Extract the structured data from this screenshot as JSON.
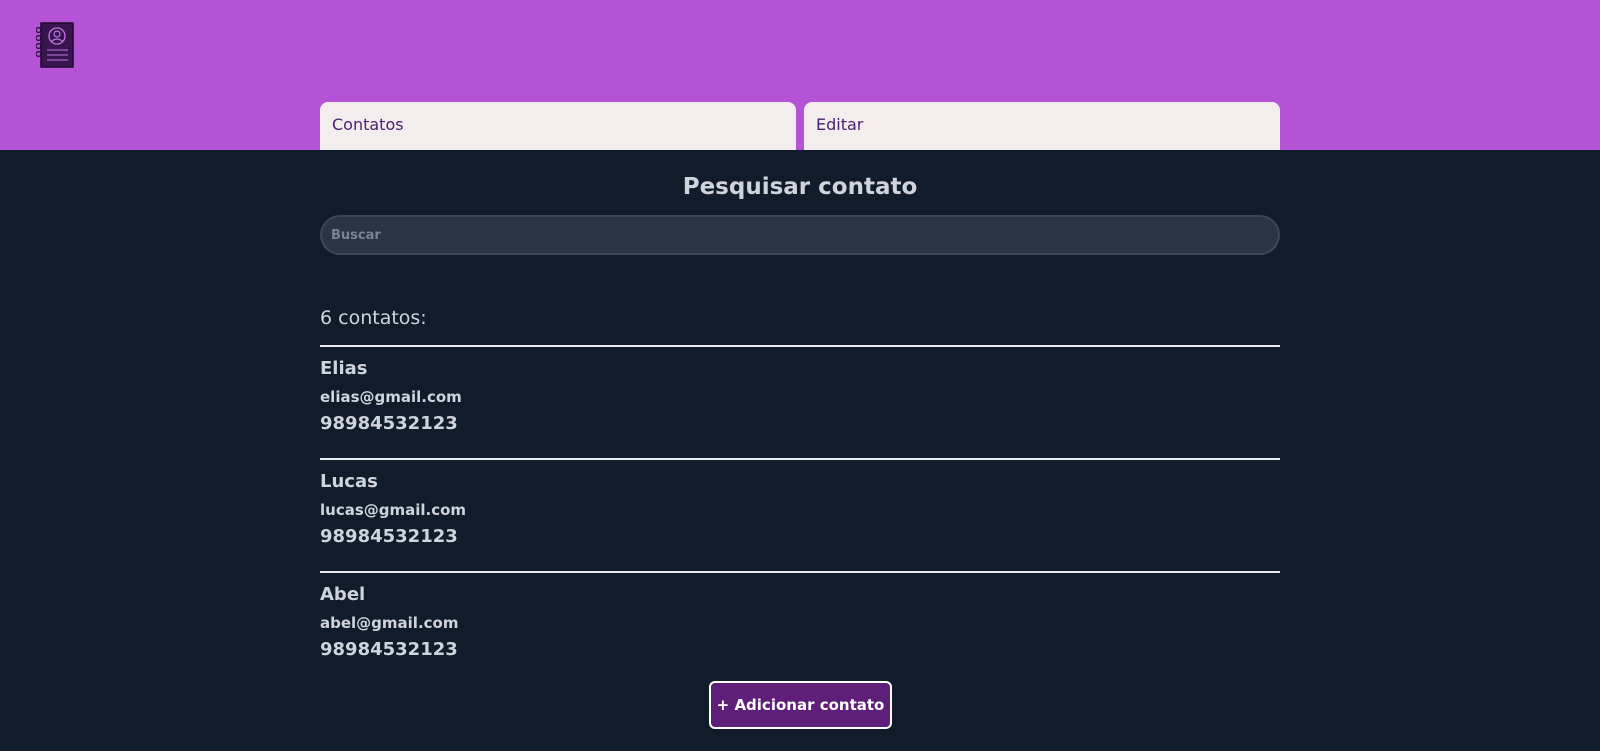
{
  "header": {
    "logo_icon": "contact-book-icon",
    "background_color": "#b553d7"
  },
  "tabs": [
    {
      "label": "Contatos"
    },
    {
      "label": "Editar"
    }
  ],
  "main": {
    "title": "Pesquisar contato",
    "search": {
      "placeholder": "Buscar",
      "value": ""
    },
    "count_label": "6 contatos:",
    "contacts": [
      {
        "name": "Elias",
        "email": "elias@gmail.com",
        "phone": "98984532123"
      },
      {
        "name": "Lucas",
        "email": "lucas@gmail.com",
        "phone": "98984532123"
      },
      {
        "name": "Abel",
        "email": "abel@gmail.com",
        "phone": "98984532123"
      }
    ],
    "add_button_label": "+ Adicionar contato"
  },
  "colors": {
    "accent": "#b553d7",
    "background": "#111c2b",
    "button": "#5e1f78",
    "tab_text": "#4a2170"
  }
}
